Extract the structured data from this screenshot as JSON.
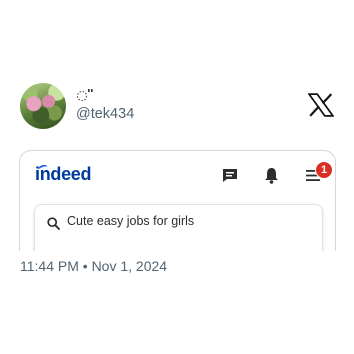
{
  "author": {
    "handle": "@tek434",
    "avatar_icon": "avatar-photo"
  },
  "platform_icon": "x-logo-icon",
  "embedded_app": {
    "brand": "indeed",
    "brand_color": "#003a9b",
    "icons": [
      "message-icon",
      "bell-icon",
      "menu-icon"
    ],
    "notification_count": "1",
    "search": {
      "query": "Cute easy jobs for girls"
    }
  },
  "timestamp": "11:44 PM • Nov 1, 2024"
}
